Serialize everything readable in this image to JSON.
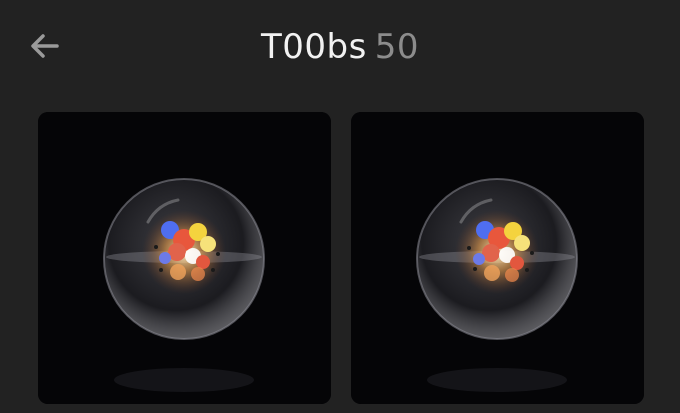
{
  "header": {
    "title": "T00bs",
    "count": "50",
    "back_icon": "arrow-left-icon"
  },
  "colors": {
    "background": "#222222",
    "title": "#f2f2f2",
    "count": "#8c8c8c",
    "card_background": "#050507"
  },
  "grid": {
    "items": [
      {
        "icon": "glass-sphere-thumbnail"
      },
      {
        "icon": "glass-sphere-thumbnail"
      }
    ]
  }
}
